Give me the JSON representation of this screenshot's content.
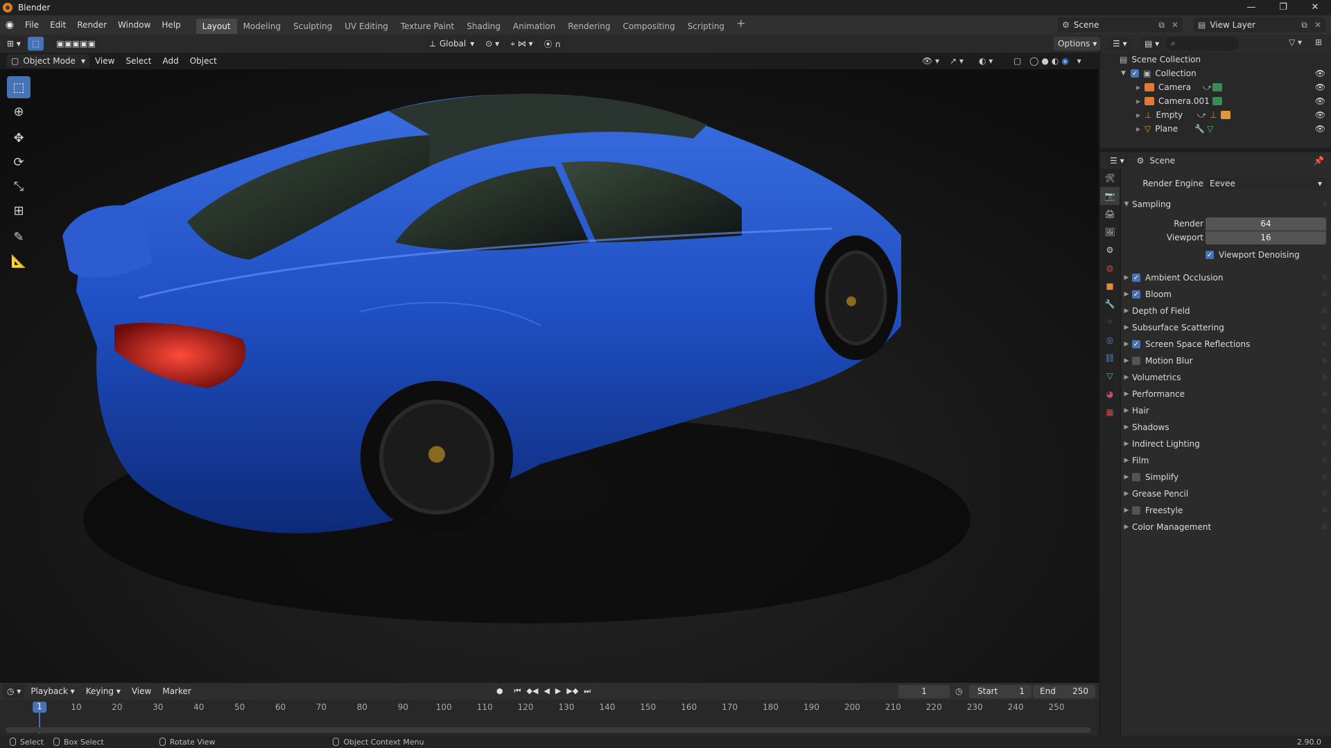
{
  "window": {
    "title": "Blender",
    "minimize": "—",
    "restore": "❐",
    "close": "✕"
  },
  "menu": [
    "File",
    "Edit",
    "Render",
    "Window",
    "Help"
  ],
  "workspaces": [
    "Layout",
    "Modeling",
    "Sculpting",
    "UV Editing",
    "Texture Paint",
    "Shading",
    "Animation",
    "Rendering",
    "Compositing",
    "Scripting"
  ],
  "active_workspace": "Layout",
  "scene_name": "Scene",
  "view_layer": "View Layer",
  "viewport": {
    "transform_orientation": "Global",
    "options_label": "Options",
    "mode": "Object Mode",
    "menus": [
      "View",
      "Select",
      "Add",
      "Object"
    ]
  },
  "outliner": {
    "root": "Scene Collection",
    "collection": "Collection",
    "items": [
      "Camera",
      "Camera.001",
      "Empty",
      "Plane"
    ]
  },
  "properties": {
    "context": "Scene",
    "render_engine_label": "Render Engine",
    "render_engine": "Eevee",
    "sampling": {
      "title": "Sampling",
      "render_label": "Render",
      "render": "64",
      "viewport_label": "Viewport",
      "viewport": "16",
      "denoise_label": "Viewport Denoising"
    },
    "panels": [
      {
        "label": "Ambient Occlusion",
        "checkbox": true,
        "checked": true
      },
      {
        "label": "Bloom",
        "checkbox": true,
        "checked": true
      },
      {
        "label": "Depth of Field",
        "checkbox": false
      },
      {
        "label": "Subsurface Scattering",
        "checkbox": false
      },
      {
        "label": "Screen Space Reflections",
        "checkbox": true,
        "checked": true
      },
      {
        "label": "Motion Blur",
        "checkbox": true,
        "checked": false
      },
      {
        "label": "Volumetrics",
        "checkbox": false
      },
      {
        "label": "Performance",
        "checkbox": false
      },
      {
        "label": "Hair",
        "checkbox": false
      },
      {
        "label": "Shadows",
        "checkbox": false
      },
      {
        "label": "Indirect Lighting",
        "checkbox": false
      },
      {
        "label": "Film",
        "checkbox": false
      },
      {
        "label": "Simplify",
        "checkbox": true,
        "checked": false
      },
      {
        "label": "Grease Pencil",
        "checkbox": false
      },
      {
        "label": "Freestyle",
        "checkbox": true,
        "checked": false
      },
      {
        "label": "Color Management",
        "checkbox": false
      }
    ]
  },
  "timeline": {
    "menus": [
      "Playback",
      "Keying",
      "View",
      "Marker"
    ],
    "current_frame": "1",
    "start_label": "Start",
    "start": "1",
    "end_label": "End",
    "end": "250",
    "ticks": [
      "1",
      "10",
      "20",
      "30",
      "40",
      "50",
      "60",
      "70",
      "80",
      "90",
      "100",
      "110",
      "120",
      "130",
      "140",
      "150",
      "160",
      "170",
      "180",
      "190",
      "200",
      "210",
      "220",
      "230",
      "240",
      "250"
    ]
  },
  "status": {
    "select": "Select",
    "box_select": "Box Select",
    "rotate": "Rotate View",
    "context_menu": "Object Context Menu",
    "version": "2.90.0"
  }
}
